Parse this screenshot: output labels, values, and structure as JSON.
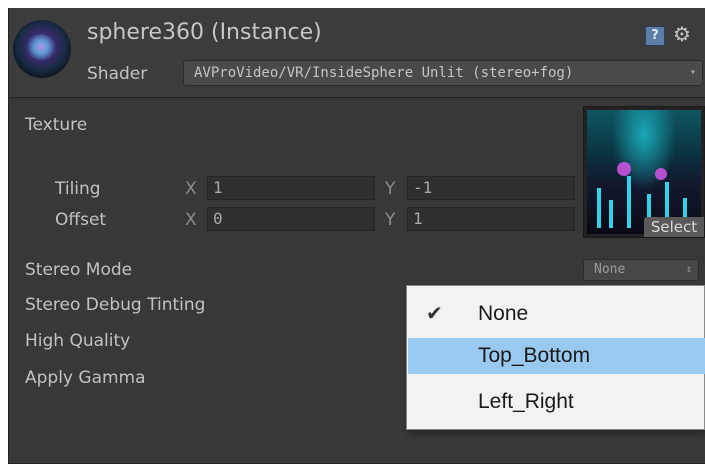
{
  "material": {
    "title": "sphere360 (Instance)",
    "shader_label": "Shader",
    "shader_value": "AVProVideo/VR/InsideSphere Unlit (stereo+fog)",
    "help_icon": "help-book-icon",
    "gear_icon": "gear-icon"
  },
  "properties": {
    "texture_label": "Texture",
    "tiling": {
      "label": "Tiling",
      "x_axis": "X",
      "x_value": "1",
      "y_axis": "Y",
      "y_value": "-1"
    },
    "offset": {
      "label": "Offset",
      "x_axis": "X",
      "x_value": "0",
      "y_axis": "Y",
      "y_value": "1"
    },
    "select_label": "Select",
    "stereo_mode_label": "Stereo Mode",
    "stereo_mode_value": "None",
    "stereo_debug_label": "Stereo Debug Tinting",
    "high_quality_label": "High Quality",
    "apply_gamma_label": "Apply Gamma"
  },
  "popup": {
    "items": [
      {
        "label": "None",
        "checked": true,
        "highlighted": false
      },
      {
        "label": "Top_Bottom",
        "checked": false,
        "highlighted": true
      },
      {
        "label": "Left_Right",
        "checked": false,
        "highlighted": false
      }
    ]
  },
  "colors": {
    "panel_bg": "#383838",
    "menu_highlight": "#99c9ef",
    "menu_bg": "#f2f2f2"
  }
}
